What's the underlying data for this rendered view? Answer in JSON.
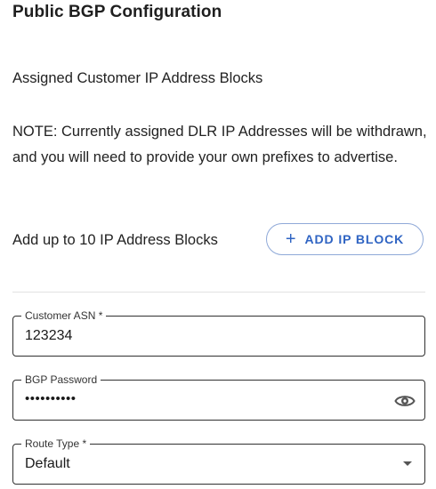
{
  "page": {
    "title": "Public BGP Configuration"
  },
  "section": {
    "label": "Assigned Customer IP Address Blocks",
    "note": "NOTE: Currently assigned DLR IP Addresses will be withdrawn, and you will need to provide your own prefixes to advertise."
  },
  "add_ip": {
    "hint": "Add up to 10 IP Address Blocks",
    "button_label": "ADD IP BLOCK",
    "button_icon": "plus-icon"
  },
  "form": {
    "customer_asn": {
      "label": "Customer ASN *",
      "value": "123234"
    },
    "bgp_password": {
      "label": "BGP Password",
      "value": "••••••••••",
      "icon": "eye-icon"
    },
    "route_type": {
      "label": "Route Type *",
      "value": "Default",
      "icon": "dropdown-caret-icon"
    }
  },
  "colors": {
    "accent": "#2f64c3",
    "button_border": "#8fa9d8",
    "field_border": "#303030",
    "divider": "#e2e2e2"
  }
}
